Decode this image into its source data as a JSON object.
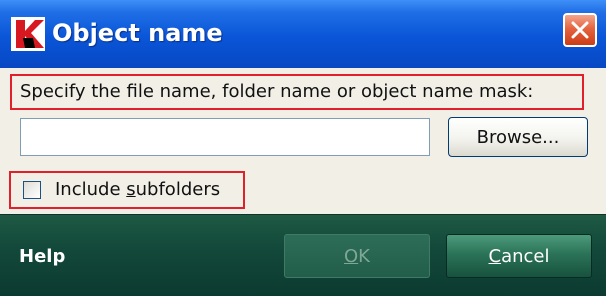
{
  "window": {
    "title": "Object name",
    "app_icon": "kaspersky-k-icon",
    "close_icon": "close-icon",
    "accent_color": "#0a55d8",
    "close_color": "#e4643f"
  },
  "form": {
    "prompt": "Specify the file name, folder name or object name mask:",
    "path_value": "",
    "browse_label": "Browse...",
    "include_subfolders": {
      "label_prefix": "Include ",
      "label_mnemonic": "s",
      "label_suffix": "ubfolders",
      "checked": false
    },
    "highlight_color": "#e0202a"
  },
  "footer": {
    "help_label": "Help",
    "ok": {
      "mnemonic": "O",
      "rest": "K",
      "enabled": false
    },
    "cancel": {
      "mnemonic": "C",
      "rest": "ancel",
      "enabled": true
    },
    "background_color": "#13493a"
  }
}
